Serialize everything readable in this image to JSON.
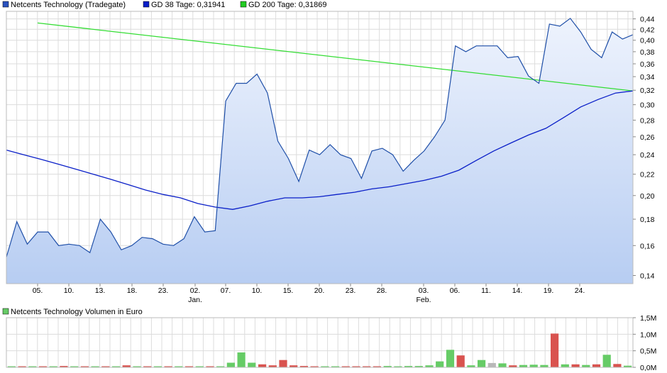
{
  "colors": {
    "price_line": "#1f4fa8",
    "price_fill_top": "#eef3fd",
    "price_fill_bottom": "#b7cdf2",
    "gd38_line": "#0a1fc8",
    "gd200_line": "#33dd33",
    "grid": "#dcdcdc",
    "volume_up": "#66cc66",
    "volume_down": "#d9534f",
    "volume_neutral": "#b8b8b8"
  },
  "price_chart": {
    "legend": [
      {
        "label": "Netcents Technology (Tradegate)",
        "color": "#2a52be",
        "icon": "legend-square"
      },
      {
        "label": "GD 38 Tage: 0,31941",
        "color": "#0a1fc8",
        "icon": "legend-square"
      },
      {
        "label": "GD 200 Tage: 0,31869",
        "color": "#22cc22",
        "icon": "legend-square"
      }
    ],
    "y_ticks": [
      "0,44",
      "0,42",
      "0,40",
      "0,38",
      "0,36",
      "0,34",
      "0,32",
      "0,30",
      "0,28",
      "0,26",
      "0,24",
      "0,22",
      "0,20",
      "0,18",
      "0,16",
      "0,14"
    ],
    "x_ticks": [
      "05.",
      "10.",
      "13.",
      "18.",
      "23.",
      "02.",
      "07.",
      "10.",
      "15.",
      "20.",
      "23.",
      "28.",
      "03.",
      "06.",
      "11.",
      "14.",
      "19.",
      "24."
    ],
    "month_labels": [
      "Jan.",
      "Feb."
    ]
  },
  "volume_chart": {
    "legend": {
      "label": "Netcents Technology Volumen in Euro",
      "color": "#66cc66",
      "icon": "legend-square"
    },
    "y_ticks": [
      "1,5M",
      "1,0M",
      "0,5M",
      "0,0M"
    ]
  },
  "chart_data": [
    {
      "type": "line",
      "title": "",
      "y_scale": "log",
      "ylim": [
        0.135,
        0.455
      ],
      "grid": true,
      "legend_position": "top-left",
      "x_tick_labels": [
        "05.",
        "10.",
        "13.",
        "18.",
        "23.",
        "02.",
        "07.",
        "10.",
        "15.",
        "20.",
        "23.",
        "28.",
        "03.",
        "06.",
        "11.",
        "14.",
        "19.",
        "24."
      ],
      "month_labels": [
        "Jan.",
        "Feb."
      ],
      "series": [
        {
          "name": "Netcents Technology (Tradegate)",
          "style": "area",
          "values": [
            0.152,
            0.178,
            0.161,
            0.17,
            0.17,
            0.16,
            0.161,
            0.16,
            0.155,
            0.18,
            0.17,
            0.157,
            0.16,
            0.166,
            0.165,
            0.161,
            0.16,
            0.165,
            0.182,
            0.17,
            0.171,
            0.305,
            0.33,
            0.33,
            0.344,
            0.316,
            0.255,
            0.236,
            0.213,
            0.245,
            0.24,
            0.251,
            0.24,
            0.236,
            0.216,
            0.244,
            0.247,
            0.24,
            0.223,
            0.234,
            0.244,
            0.26,
            0.28,
            0.39,
            0.38,
            0.39,
            0.39,
            0.39,
            0.37,
            0.372,
            0.341,
            0.33,
            0.43,
            0.426,
            0.441,
            0.415,
            0.384,
            0.37,
            0.415,
            0.402,
            0.41
          ]
        },
        {
          "name": "GD 38 Tage: 0,31941",
          "style": "line",
          "values": [
            0.245,
            0.24,
            0.235,
            0.23,
            0.225,
            0.22,
            0.215,
            0.21,
            0.205,
            0.201,
            0.198,
            0.193,
            0.19,
            0.188,
            0.191,
            0.195,
            0.198,
            0.198,
            0.199,
            0.201,
            0.203,
            0.206,
            0.208,
            0.211,
            0.214,
            0.218,
            0.224,
            0.234,
            0.244,
            0.253,
            0.262,
            0.27,
            0.283,
            0.297,
            0.307,
            0.316,
            0.319
          ]
        },
        {
          "name": "GD 200 Tage: 0,31869",
          "style": "line",
          "values": [
            0.432,
            0.319
          ]
        }
      ]
    },
    {
      "type": "bar",
      "title": "",
      "name": "Netcents Technology Volumen in Euro",
      "ylim": [
        0,
        1.5
      ],
      "grid": true,
      "legend_position": "top-left",
      "y_tick_labels": [
        "1,5M",
        "1,0M",
        "0,5M",
        "0,0M"
      ],
      "values": [
        0.02,
        0.02,
        0.02,
        0.01,
        0.02,
        0.04,
        0.01,
        0.02,
        0.01,
        0.01,
        0.02,
        0.06,
        0.01,
        0.02,
        0.03,
        0.02,
        0.02,
        0.03,
        0.02,
        0.03,
        0.03,
        0.14,
        0.45,
        0.14,
        0.09,
        0.06,
        0.22,
        0.06,
        0.04,
        0.03,
        0.03,
        0.03,
        0.03,
        0.03,
        0.03,
        0.03,
        0.04,
        0.03,
        0.04,
        0.04,
        0.06,
        0.18,
        0.53,
        0.36,
        0.06,
        0.22,
        0.13,
        0.12,
        0.06,
        0.07,
        0.08,
        0.07,
        1.02,
        0.09,
        0.09,
        0.07,
        0.09,
        0.38,
        0.1,
        0.05
      ],
      "directions": [
        "u",
        "d",
        "u",
        "d",
        "u",
        "d",
        "u",
        "d",
        "u",
        "d",
        "u",
        "d",
        "u",
        "d",
        "u",
        "d",
        "u",
        "d",
        "u",
        "d",
        "u",
        "u",
        "u",
        "u",
        "d",
        "d",
        "d",
        "d",
        "d",
        "d",
        "u",
        "u",
        "d",
        "d",
        "d",
        "d",
        "u",
        "u",
        "u",
        "u",
        "u",
        "u",
        "u",
        "d",
        "u",
        "u",
        "n",
        "u",
        "d",
        "u",
        "u",
        "u",
        "d",
        "u",
        "d",
        "u",
        "d",
        "u",
        "d",
        "u"
      ]
    }
  ]
}
